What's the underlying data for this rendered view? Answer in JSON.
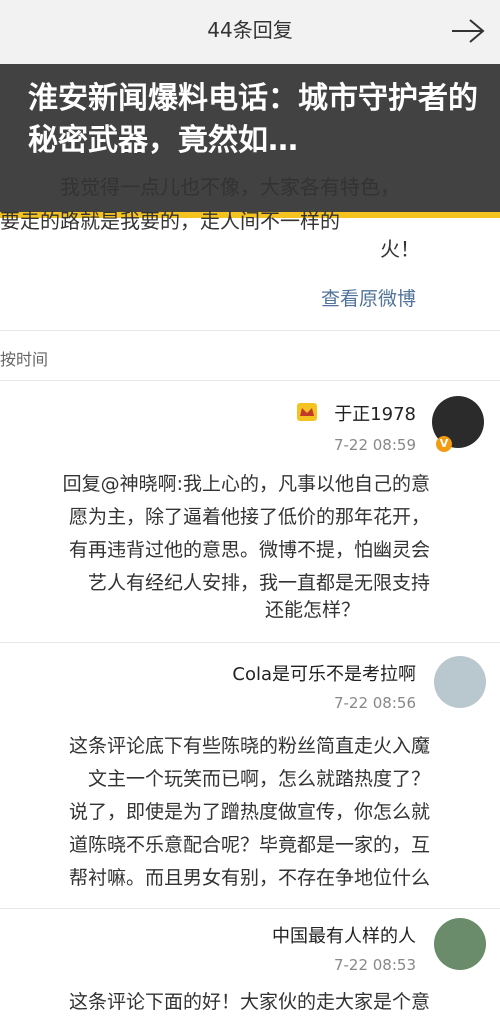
{
  "header": {
    "title": "44条回复",
    "back_icon": "arrow-icon"
  },
  "banner": {
    "headline": "淮安新闻爆料电话：城市守护者的秘密武器，竟然如…",
    "accent_color": "#f4c31f"
  },
  "top_post": {
    "lines": [
      "我觉得一点儿也不像，大家各有特色，",
      "要走的路就是我要的，走人间不一样的",
      "火！"
    ],
    "view_link": "查看原微博"
  },
  "sort_label": "按时间",
  "comments": [
    {
      "username": "于正1978",
      "time": "7-22 08:59",
      "lines": [
        "回复@神晓啊:我上心的，凡事以他自己的意",
        "愿为主，除了逼着他接了低价的那年花开，",
        "有再违背过他的意思。微博不提，怕幽灵会",
        "艺人有经纪人安排，我一直都是无限支持",
        "还能怎样？"
      ]
    },
    {
      "username": "Cola是可乐不是考拉啊",
      "time": "7-22 08:56",
      "lines": [
        "这条评论底下有些陈晓的粉丝简直走火入魔",
        "文主一个玩笑而已啊，怎么就踏热度了？",
        "说了，即使是为了蹭热度做宣传，你怎么就",
        "道陈晓不乐意配合呢？毕竟都是一家的，互",
        "帮衬嘛。而且男女有别，不存在争地位什么"
      ]
    },
    {
      "username": "中国最有人样的人",
      "time": "7-22 08:53",
      "lines": [
        "这条评论下面的好！大家伙的走大家是个意"
      ]
    }
  ]
}
